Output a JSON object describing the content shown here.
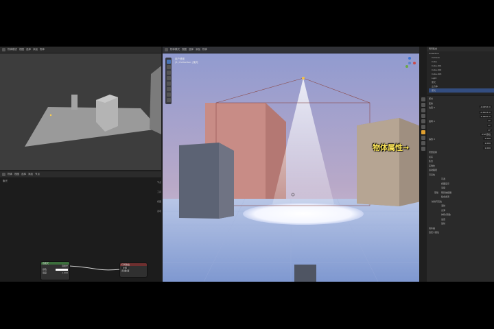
{
  "small_viewport": {
    "header_items": [
      "物体模式",
      "视图",
      "选择",
      "添加",
      "物体"
    ]
  },
  "node_editor": {
    "header_items": [
      "物体",
      "视图",
      "选择",
      "添加",
      "节点"
    ],
    "breadcrumb": "聚光",
    "node_emission": {
      "title": "自发光",
      "output": "自发光",
      "color_label": "颜色",
      "strength_label": "强度",
      "strength_value": "1.000"
    },
    "node_output": {
      "title": "灯光输出",
      "target": "全部",
      "input": "表(曲)面"
    },
    "side_tabs": [
      "节点",
      "工具",
      "视图",
      "选项"
    ]
  },
  "main_viewport": {
    "header_items": [
      "物体模式",
      "视图",
      "选择",
      "添加",
      "物体"
    ],
    "overlay_title": "用户透视",
    "overlay_sub": "(1) Collection | 聚光"
  },
  "outliner": {
    "title": "场景集合",
    "collection": "Collection",
    "items": [
      "Camera",
      "Cube",
      "Cube.001",
      "Cube.002",
      "Cube.003",
      "Light",
      "聚光",
      "立方体",
      "聚光"
    ]
  },
  "properties": {
    "object_name": "聚光",
    "sections": {
      "transform": "变换",
      "location_label": "位置 X",
      "location_values": [
        "-1.0452 m",
        "-0.3203 m",
        "5.1805 m"
      ],
      "rotation_label": "旋转 X",
      "rotation_values": [
        "0°",
        "0°",
        "0°"
      ],
      "rotation_mode": "XYZ 欧拉",
      "scale_label": "缩放 X",
      "scale_values": [
        "1.000",
        "1.000",
        "1.000"
      ],
      "collapsed": [
        "增量变换",
        "关系",
        "集合",
        "实例化",
        "运动路径"
      ],
      "visibility": "可见性",
      "visibility_items": [
        "可选",
        "视图显示",
        "渲染"
      ],
      "mask_label": "蒙版",
      "mask_items": [
        "阴影捕捉器",
        "集合遮罩"
      ],
      "ray_vis": "射线可见性",
      "ray_items": [
        "漫射",
        "光泽",
        "体积(音量)",
        "设置",
        "透射"
      ],
      "line_art": "线条画",
      "custom_props": "自定义属性"
    }
  },
  "annotation": {
    "text": "物体属性→"
  },
  "colors": {
    "accent": "#ffe85a",
    "selection": "#334d80"
  }
}
